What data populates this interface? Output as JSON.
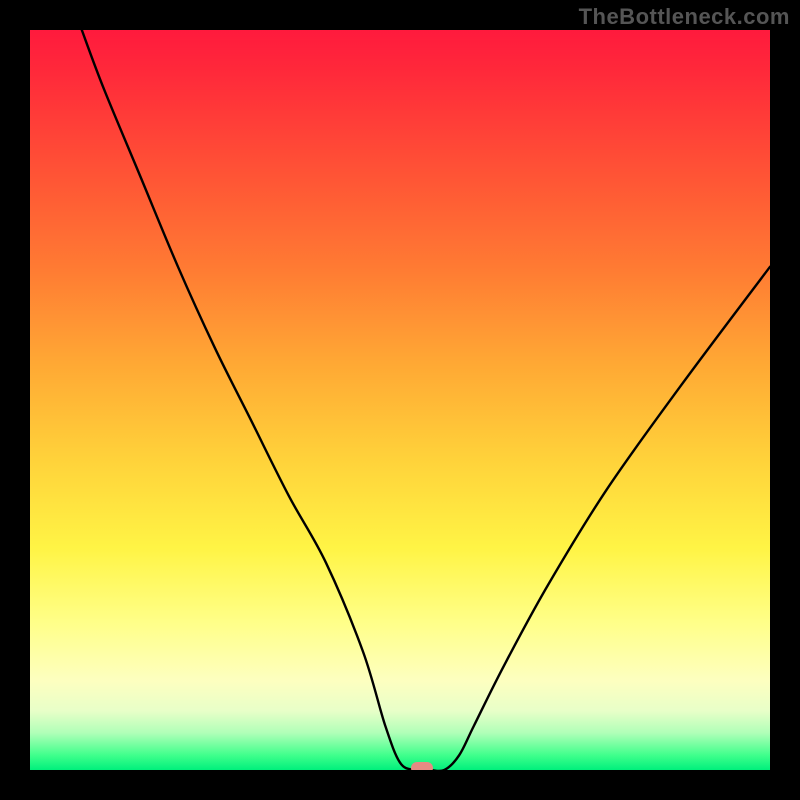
{
  "watermark": "TheBottleneck.com",
  "chart_data": {
    "type": "line",
    "title": "",
    "xlabel": "",
    "ylabel": "",
    "xlim": [
      0,
      100
    ],
    "ylim": [
      0,
      100
    ],
    "grid": false,
    "legend": false,
    "background": "red-yellow-green vertical gradient",
    "series": [
      {
        "name": "bottleneck-curve",
        "x": [
          7,
          10,
          15,
          20,
          25,
          30,
          35,
          40,
          45,
          48,
          50,
          52,
          54,
          56,
          58,
          60,
          64,
          70,
          78,
          88,
          100
        ],
        "values": [
          100,
          92,
          80,
          68,
          57,
          47,
          37,
          28,
          16,
          6,
          1,
          0,
          0,
          0,
          2,
          6,
          14,
          25,
          38,
          52,
          68
        ]
      }
    ],
    "marker": {
      "x": 53,
      "y": 0,
      "color": "#e58b83",
      "shape": "rounded-rect"
    },
    "colors": {
      "curve": "#000000",
      "frame": "#000000",
      "gradient_stops": [
        "#ff1a3d",
        "#ff7a33",
        "#ffd23a",
        "#fff445",
        "#40ff8c",
        "#00f07c"
      ]
    }
  }
}
